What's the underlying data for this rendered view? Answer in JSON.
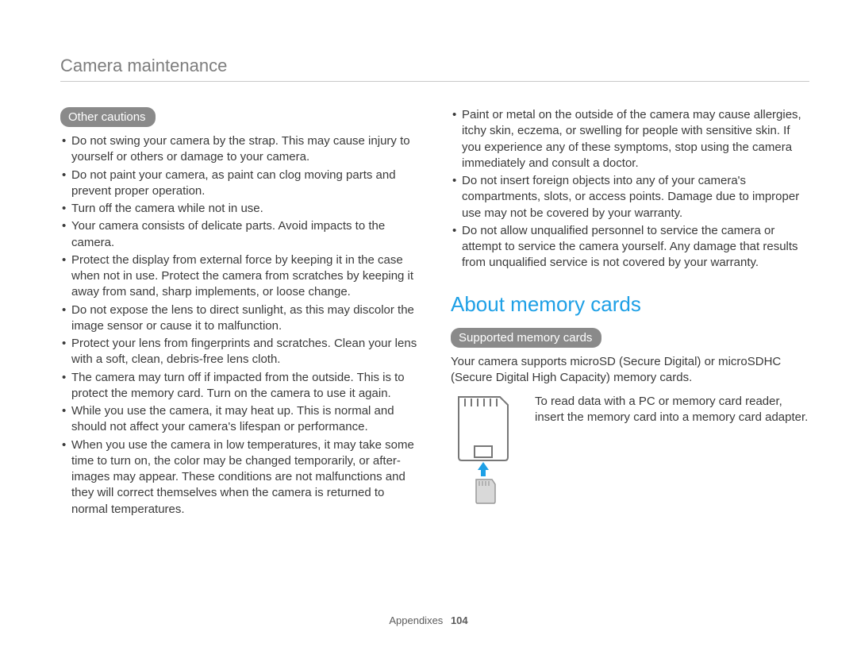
{
  "header": {
    "title": "Camera maintenance"
  },
  "left": {
    "pill": "Other cautions",
    "bullets": [
      "Do not swing your camera by the strap. This may cause injury to yourself or others or damage to your camera.",
      "Do not paint your camera, as paint can clog moving parts and prevent proper operation.",
      "Turn off the camera while not in use.",
      "Your camera consists of delicate parts. Avoid impacts to the camera.",
      "Protect the display from external force by keeping it in the case when not in use. Protect the camera from scratches by keeping it away from sand, sharp implements, or loose change.",
      "Do not expose the lens to direct sunlight, as this may discolor the image sensor or cause it to malfunction.",
      "Protect your lens from fingerprints and scratches. Clean your lens with a soft, clean, debris-free lens cloth.",
      "The camera may turn off if impacted from the outside. This is to protect the memory card. Turn on the camera to use it again.",
      "While you use the camera, it may heat up. This is normal and should not affect your camera's lifespan or performance.",
      "When you use the camera in low temperatures, it may take some time to turn on, the color may be changed temporarily, or after-images may appear. These conditions are not malfunctions and they will correct themselves when the camera is returned to normal temperatures."
    ]
  },
  "right": {
    "top_bullets": [
      "Paint or metal on the outside of the camera may cause allergies, itchy skin, eczema, or swelling for people with sensitive skin. If you experience any of these symptoms, stop using the camera immediately and consult a doctor.",
      "Do not insert foreign objects into any of your camera's compartments, slots, or access points. Damage due to improper use may not be covered by your warranty.",
      "Do not allow unqualified personnel to service the camera or attempt to service the camera yourself. Any damage that results from unqualified service is not covered by your warranty."
    ],
    "h2": "About memory cards",
    "pill": "Supported memory cards",
    "intro": "Your camera supports microSD (Secure Digital) or microSDHC (Secure Digital High Capacity) memory cards.",
    "adapter_text": "To read data with a PC or memory card reader, insert the memory card into a memory card adapter."
  },
  "footer": {
    "section": "Appendixes",
    "page": "104"
  },
  "icons": {
    "sd_adapter": "sd-adapter-icon",
    "micro_sd": "micro-sd-icon",
    "arrow_up": "arrow-up-icon"
  }
}
